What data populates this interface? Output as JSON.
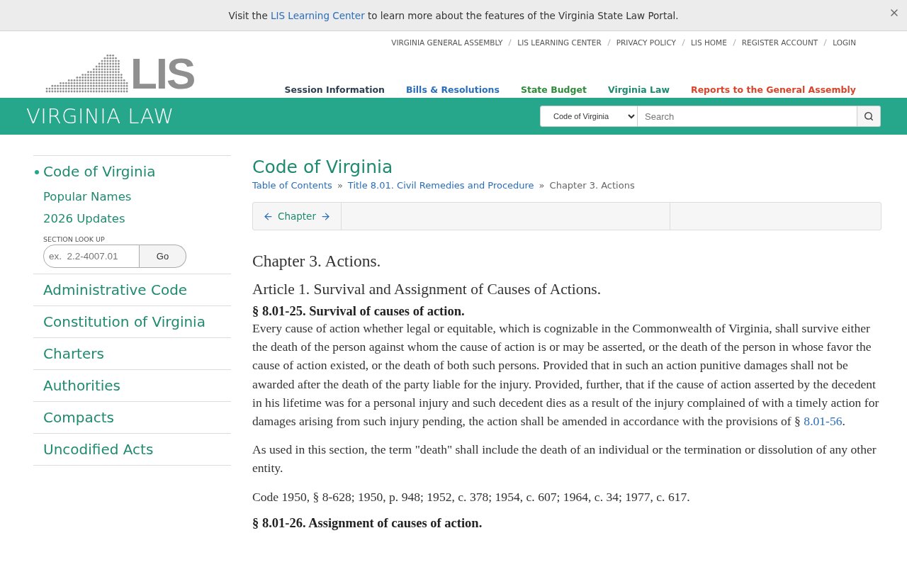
{
  "banner": {
    "text_before": "Visit the",
    "link": "LIS Learning Center",
    "text_after": "to learn more about the features of the Virginia State Law Portal."
  },
  "top_links": [
    "VIRGINIA GENERAL ASSEMBLY",
    "LIS LEARNING CENTER",
    "PRIVACY POLICY",
    "LIS HOME",
    "REGISTER ACCOUNT",
    "LOGIN"
  ],
  "logo": {
    "text": "LIS"
  },
  "main_nav": [
    {
      "label": "Session Information",
      "color": "#2d3e50"
    },
    {
      "label": "Bills & Resolutions",
      "color": "#2a6ebb"
    },
    {
      "label": "State Budget",
      "color": "#2e8b3a"
    },
    {
      "label": "Virginia Law",
      "color": "#1f8a6f"
    },
    {
      "label": "Reports to the General Assembly",
      "color": "#d9442a"
    }
  ],
  "band": {
    "title": "VIRGINIA LAW",
    "search_scope": "Code of Virginia",
    "search_placeholder": "Search"
  },
  "sidebar": {
    "items": [
      {
        "label": "Code of Virginia",
        "selected": true,
        "children": [
          {
            "label": "Popular Names"
          },
          {
            "label": "2026 Updates"
          }
        ],
        "lookup": {
          "label": "SECTION LOOK UP",
          "placeholder": "ex.  2.2-4007.01",
          "button": "Go"
        }
      },
      {
        "label": "Administrative Code",
        "selected": false
      },
      {
        "label": "Constitution of Virginia",
        "selected": false
      },
      {
        "label": "Charters",
        "selected": false
      },
      {
        "label": "Authorities",
        "selected": false
      },
      {
        "label": "Compacts",
        "selected": false
      },
      {
        "label": "Uncodified Acts",
        "selected": false
      }
    ]
  },
  "content": {
    "title": "Code of Virginia",
    "breadcrumb": [
      {
        "text": "Table of Contents",
        "kind": "link"
      },
      {
        "text": "»",
        "kind": "separator"
      },
      {
        "text": "Title 8.01. Civil Remedies and Procedure",
        "kind": "link"
      },
      {
        "text": "»",
        "kind": "separator"
      },
      {
        "text": "Chapter 3. Actions",
        "kind": "current"
      }
    ],
    "pager": {
      "label": "Chapter"
    },
    "chapter_heading": "Chapter 3. Actions.",
    "article_heading": "Article 1. Survival and Assignment of Causes of Actions.",
    "sections": [
      {
        "heading": "§ 8.01-25. Survival of causes of action.",
        "paragraphs": [
          {
            "text": "Every cause of action whether legal or equitable, which is cognizable in the Commonwealth of Virginia, shall survive either the death of the person against whom the cause of action is or may be asserted, or the death of the person in whose favor the cause of action existed, or the death of both such persons. Provided that in such an action punitive damages shall not be awarded after the death of the party liable for the injury. Provided, further, that if the cause of action asserted by the decedent in his lifetime was for a personal injury and such decedent dies as a result of the injury complained of with a timely action for damages arising from such injury pending, the action shall be amended in accordance with the provisions of §",
            "link": "8.01-56",
            "text_after": "."
          },
          {
            "text": "As used in this section, the term \"death\" shall include the death of an individual or the termination or dissolution of any other entity."
          },
          {
            "text": "Code 1950, § 8-628; 1950, p. 948; 1952, c. 378; 1954, c. 607; 1964, c. 34; 1977, c. 617."
          }
        ]
      },
      {
        "heading": "§ 8.01-26. Assignment of causes of action."
      }
    ]
  }
}
